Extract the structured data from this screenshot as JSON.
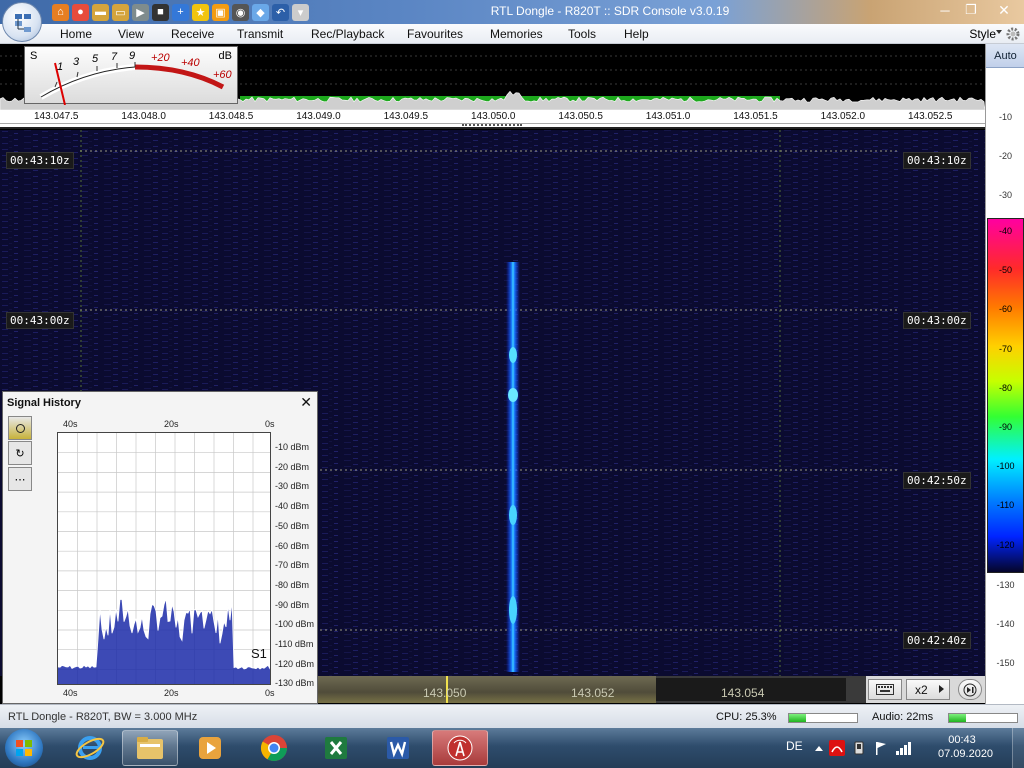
{
  "window": {
    "title": "RTL Dongle - R820T :: SDR Console v3.0.19",
    "controls": {
      "minimize": "─",
      "restore": "❐",
      "close": "✕"
    }
  },
  "quick_access": [
    "home-icon",
    "record-icon",
    "folder-icon",
    "folder-open-icon",
    "play-icon",
    "record-stop-icon",
    "add-icon",
    "star-icon",
    "lock-icon",
    "camera-icon",
    "drop-icon",
    "undo-icon",
    "dropdown-icon"
  ],
  "menu": {
    "items": [
      "Home",
      "View",
      "Receive",
      "Transmit",
      "Rec/Playback",
      "Favourites",
      "Memories",
      "Tools",
      "Help"
    ],
    "style_label": "Style"
  },
  "smeter": {
    "s_label": "S",
    "db_label": "dB",
    "scale_s": [
      "1",
      "3",
      "5",
      "7",
      "9"
    ],
    "scale_plus": [
      "+20",
      "+40",
      "+60"
    ]
  },
  "frequency_scale": {
    "ticks": [
      "143.047.5",
      "143.048.0",
      "143.048.5",
      "143.049.0",
      "143.049.5",
      "143.050.0",
      "143.050.5",
      "143.051.0",
      "143.051.5",
      "143.052.0",
      "143.052.5"
    ]
  },
  "waterfall": {
    "timestamps_left": [
      "00:43:10z",
      "00:43:00z"
    ],
    "timestamps_right": [
      "00:43:10z",
      "00:43:00z",
      "00:42:50z",
      "00:42:40z"
    ]
  },
  "db_panel": {
    "auto_label": "Auto",
    "labels_top": [
      "-10",
      "-20",
      "-30"
    ],
    "labels_color": [
      "-40",
      "-50",
      "-60",
      "-70",
      "-80",
      "-90",
      "-100",
      "-110",
      "-120"
    ],
    "labels_bottom": [
      "-130",
      "-140",
      "-150"
    ],
    "label_colors": [
      "#ff00a0",
      "#ff2a2a",
      "#ff7a00",
      "#ffd000",
      "#c6ff00",
      "#33ff33",
      "#00f0ff",
      "#007bff",
      "#0024ff"
    ]
  },
  "signal_history": {
    "title": "Signal History",
    "close": "✕",
    "x_top": [
      "40s",
      "20s",
      "0s"
    ],
    "x_bottom": [
      "40s",
      "20s",
      "0s"
    ],
    "y_labels": [
      "-10 dBm",
      "-20 dBm",
      "-30 dBm",
      "-40 dBm",
      "-50 dBm",
      "-60 dBm",
      "-70 dBm",
      "-80 dBm",
      "-90 dBm",
      "-100 dBm",
      "-110 dBm",
      "-120 dBm",
      "-130 dBm"
    ],
    "s_reading": "S1",
    "buttons": {
      "refresh": "↻",
      "more": "⋯"
    }
  },
  "tuning": {
    "freqs": [
      "143.050",
      "143.052",
      "143.054"
    ],
    "zoom_label": "x2"
  },
  "status": {
    "device": "RTL Dongle - R820T, BW = 3.000 MHz",
    "cpu_label": "CPU: 25.3%",
    "cpu_value": 25.3,
    "audio_label": "Audio: 22ms"
  },
  "taskbar": {
    "language": "DE",
    "time": "00:43",
    "date": "07.09.2020"
  }
}
